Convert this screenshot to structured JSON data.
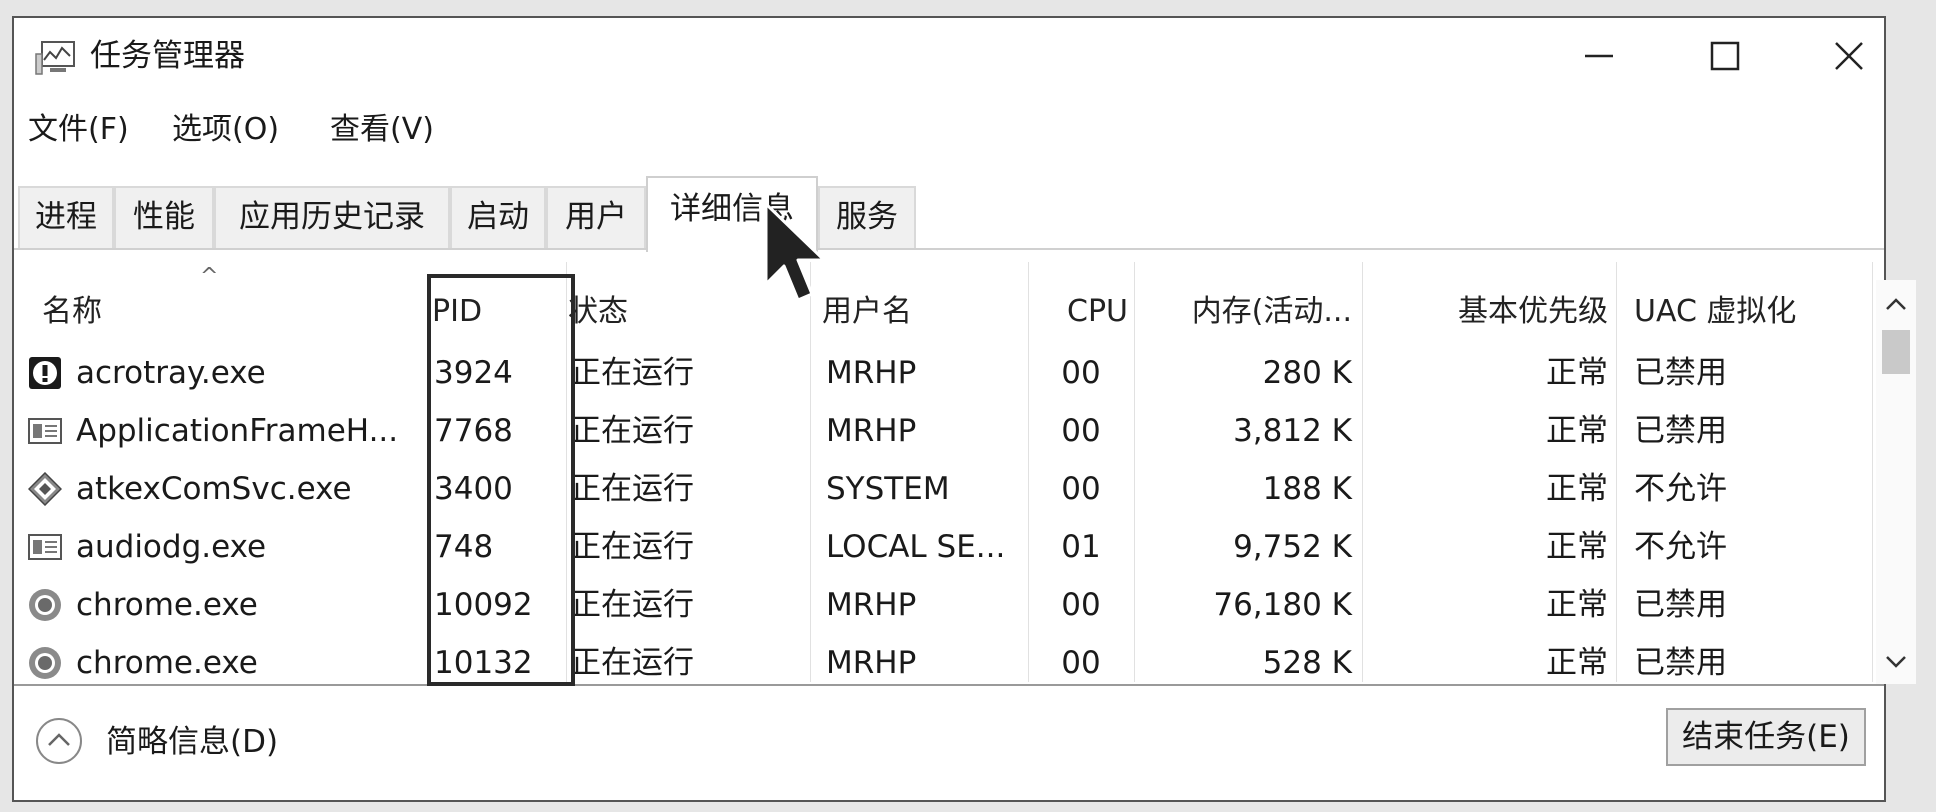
{
  "window": {
    "title": "任务管理器"
  },
  "menu": [
    "文件(F)",
    "选项(O)",
    "查看(V)"
  ],
  "tabs": [
    {
      "label": "进程",
      "active": false
    },
    {
      "label": "性能",
      "active": false
    },
    {
      "label": "应用历史记录",
      "active": false
    },
    {
      "label": "启动",
      "active": false
    },
    {
      "label": "用户",
      "active": false
    },
    {
      "label": "详细信息",
      "active": true
    },
    {
      "label": "服务",
      "active": false
    }
  ],
  "columns": {
    "name": "名称",
    "pid": "PID",
    "status": "状态",
    "user": "用户名",
    "cpu": "CPU",
    "memory": "内存(活动...",
    "priority": "基本优先级",
    "uac": "UAC 虚拟化"
  },
  "rows": [
    {
      "icon": "acrotray-icon",
      "name": "acrotray.exe",
      "pid": "3924",
      "status": "正在运行",
      "user": "MRHP",
      "cpu": "00",
      "memory": "280 K",
      "priority": "正常",
      "uac": "已禁用"
    },
    {
      "icon": "window-app-icon",
      "name": "ApplicationFrameH...",
      "pid": "7768",
      "status": "正在运行",
      "user": "MRHP",
      "cpu": "00",
      "memory": "3,812 K",
      "priority": "正常",
      "uac": "已禁用"
    },
    {
      "icon": "diamond-service-icon",
      "name": "atkexComSvc.exe",
      "pid": "3400",
      "status": "正在运行",
      "user": "SYSTEM",
      "cpu": "00",
      "memory": "188 K",
      "priority": "正常",
      "uac": "不允许"
    },
    {
      "icon": "window-app-icon",
      "name": "audiodg.exe",
      "pid": "748",
      "status": "正在运行",
      "user": "LOCAL SE...",
      "cpu": "01",
      "memory": "9,752 K",
      "priority": "正常",
      "uac": "不允许"
    },
    {
      "icon": "chrome-icon",
      "name": "chrome.exe",
      "pid": "10092",
      "status": "正在运行",
      "user": "MRHP",
      "cpu": "00",
      "memory": "76,180 K",
      "priority": "正常",
      "uac": "已禁用"
    },
    {
      "icon": "chrome-icon",
      "name": "chrome.exe",
      "pid": "10132",
      "status": "正在运行",
      "user": "MRHP",
      "cpu": "00",
      "memory": "528 K",
      "priority": "正常",
      "uac": "已禁用"
    }
  ],
  "footer": {
    "brief_label": "简略信息(D)",
    "end_task_label": "结束任务(E)"
  }
}
